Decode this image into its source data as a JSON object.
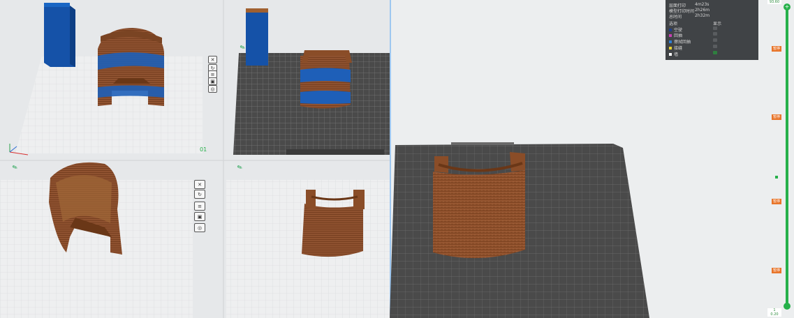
{
  "colors": {
    "accent_green": "#26b04a",
    "layer_tag": "#e8752a",
    "panel_bg": "#404346",
    "filament_brown": "#8a4d28",
    "support_blue": "#1565c0",
    "bed_dark": "#4a4a4a"
  },
  "viewport_top_left": {
    "layer_label": "01"
  },
  "stats": {
    "rows": [
      {
        "label": "层面打印",
        "value": "4m23s"
      },
      {
        "label": "模型打印时间",
        "value": "2h26m"
      },
      {
        "label": "总时间",
        "value": "2h32m"
      }
    ],
    "col_option": "选项",
    "col_show": "显示",
    "legend": [
      {
        "label": "空驶",
        "color": "#1d3f8c"
      },
      {
        "label": "回抽",
        "color": "#c83fb3"
      },
      {
        "label": "擦拭回抽",
        "color": "#2f7fd4"
      },
      {
        "label": "接缝",
        "color": "#e8d130"
      },
      {
        "label": "墙",
        "color": "#ffffff"
      }
    ]
  },
  "layer_slider": {
    "top_value": "93.60",
    "bottom_value": "0.20",
    "bottom_index": "1",
    "tags": [
      "暂停",
      "暂停",
      "暂停",
      "暂停",
      "暂停"
    ]
  },
  "toolbar_icons": [
    "close-icon",
    "rotate-icon",
    "layers-icon",
    "lock-icon",
    "view-icon"
  ]
}
